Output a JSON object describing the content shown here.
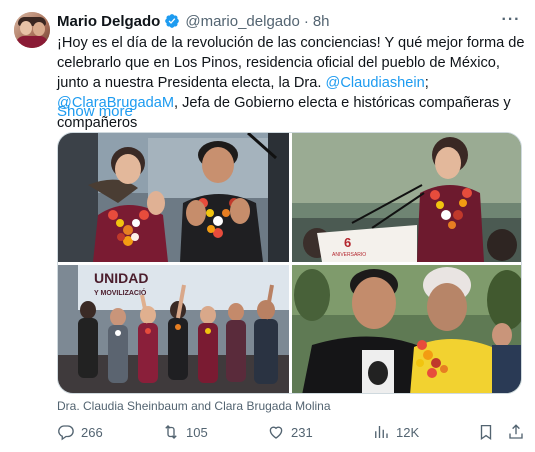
{
  "author": {
    "display_name": "Mario Delgado",
    "handle": "@mario_delgado",
    "separator": "·",
    "time": "8h",
    "verified": true
  },
  "tweet": {
    "text_part1": "¡Hoy es el día de la revolución de las conciencias! Y qué mejor forma de celebrarlo que en Los Pinos, residencia oficial del pueblo de México, junto a nuestra Presidenta electa, la Dra. ",
    "mention1": "@Claudiashein",
    "text_part2": "; ",
    "mention2": "@ClaraBrugadaM",
    "text_part3": ", Jefa de Gobierno electa e históricas compañeras y compañeros",
    "show_more": "Show more"
  },
  "media": {
    "caption": "Dra. Claudia Sheinbaum and Clara Brugada Molina",
    "photo_texts": {
      "banner": "UNIDAD",
      "banner_sub": "Y MOVILIZACIÓ",
      "podium": "6",
      "podium_sub": "ANIVERSARIO"
    }
  },
  "actions": {
    "replies": "266",
    "reposts": "105",
    "likes": "231",
    "views": "12K"
  },
  "colors": {
    "accent": "#1d9bf0",
    "text": "#0f1419",
    "muted": "#536471",
    "border": "#cfd9de"
  }
}
